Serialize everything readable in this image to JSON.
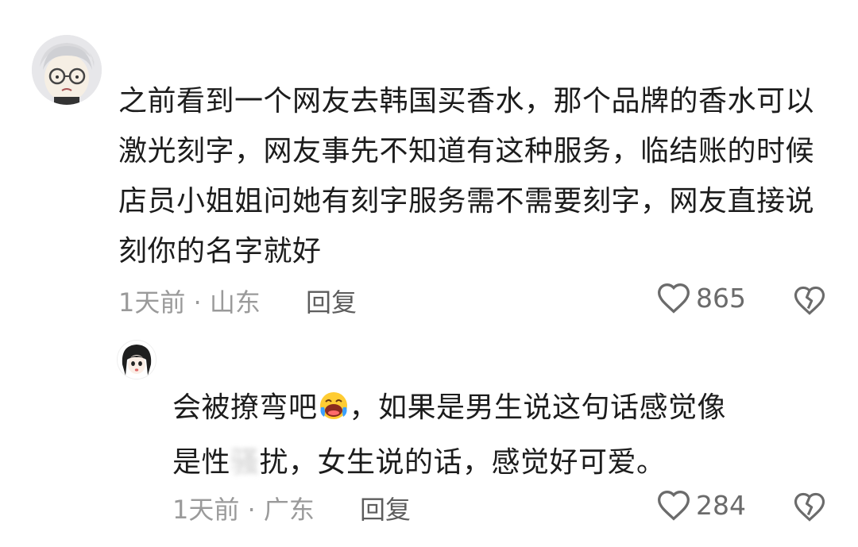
{
  "comments": [
    {
      "text": "之前看到一个网友去韩国买香水，那个品牌的香水可以激光刻字，网友事先不知道有这种服务，临结账的时候店员小姐姐问她有刻字服务需不需要刻字，网友直接说刻你的名字就好",
      "meta": "1天前 · 山东",
      "reply_label": "回复",
      "likes": "865"
    },
    {
      "text_before_emoji": "会被撩弯吧",
      "emoji": "laughing-crying-emoji",
      "text_after_emoji_line1": "，如果是男生说这句话感觉像",
      "text_line2_start": "是性",
      "text_line2_blurred": "骚",
      "text_line2_end": "扰，女生说的话，感觉好可爱。",
      "meta": "1天前 · 广东",
      "reply_label": "回复",
      "likes": "284"
    }
  ],
  "colors": {
    "text": "#1c1c1c",
    "meta": "#9a9a9a",
    "icon": "#6b6b6b"
  }
}
